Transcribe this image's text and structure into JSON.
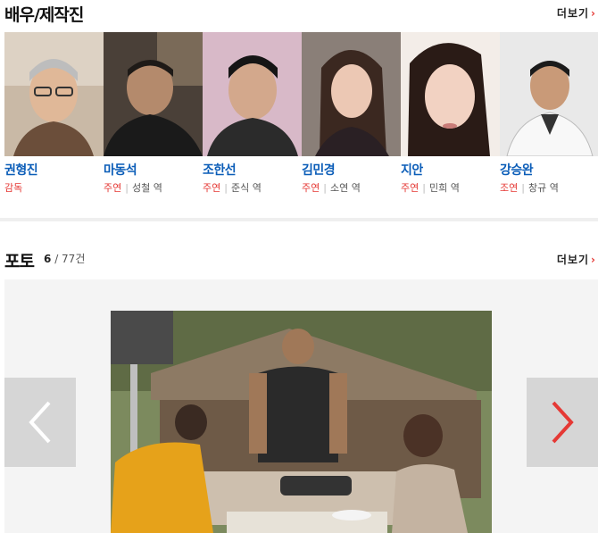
{
  "cast_section": {
    "title": "배우/제작진",
    "more_label": "더보기",
    "members": [
      {
        "name": "권형진",
        "role_type": "감독",
        "character": ""
      },
      {
        "name": "마동석",
        "role_type": "주연",
        "character": "성철 역"
      },
      {
        "name": "조한선",
        "role_type": "주연",
        "character": "준식 역"
      },
      {
        "name": "김민경",
        "role_type": "주연",
        "character": "소연 역"
      },
      {
        "name": "지안",
        "role_type": "주연",
        "character": "민희 역"
      },
      {
        "name": "강승완",
        "role_type": "조연",
        "character": "창규 역"
      }
    ]
  },
  "photo_section": {
    "title": "포토",
    "current": "6",
    "total": "/ 77건",
    "more_label": "더보기"
  },
  "colors": {
    "accent": "#e53935",
    "link": "#0b5db8"
  }
}
